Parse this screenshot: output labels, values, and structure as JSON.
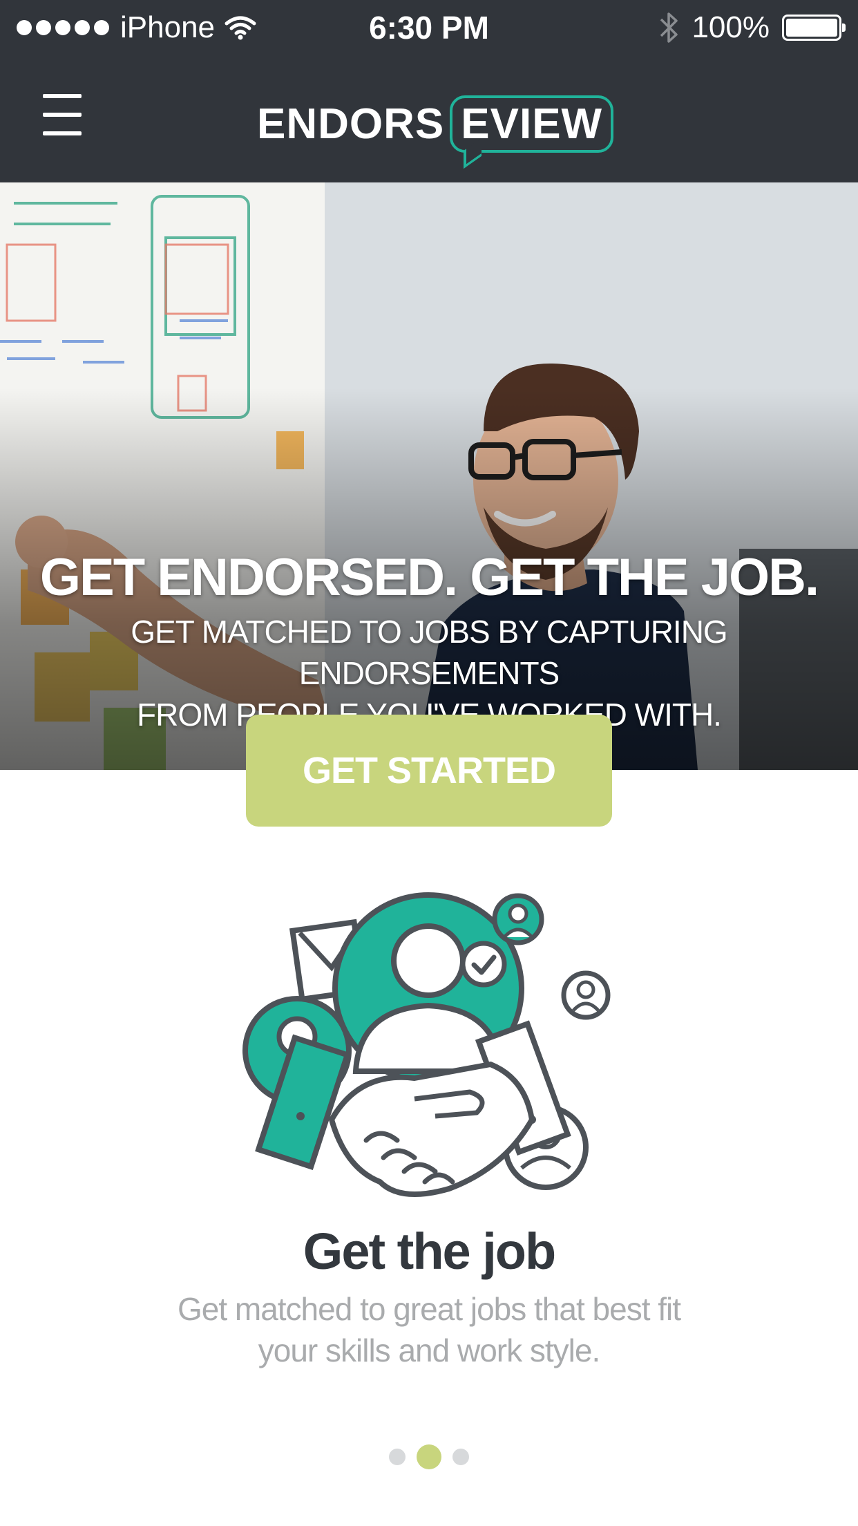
{
  "status_bar": {
    "carrier": "iPhone",
    "time": "6:30 PM",
    "battery": "100%"
  },
  "nav": {
    "logo_part1": "ENDORS",
    "logo_part2": "EVIEW"
  },
  "hero": {
    "title": "GET ENDORSED. GET THE JOB.",
    "subtitle_line1": "GET MATCHED TO JOBS BY CAPTURING ENDORSEMENTS",
    "subtitle_line2": "FROM PEOPLE YOU'VE WORKED WITH."
  },
  "cta": {
    "label": "GET STARTED"
  },
  "feature": {
    "title": "Get the job",
    "desc_line1": "Get matched to great jobs that best fit",
    "desc_line2": "your skills and work style."
  },
  "pager": {
    "total": 3,
    "active_index": 1
  },
  "colors": {
    "header_bg": "#31353b",
    "accent_teal": "#20b39a",
    "cta_green": "#c8d57d",
    "title_dark": "#33383e",
    "desc_gray": "#a9abad"
  }
}
